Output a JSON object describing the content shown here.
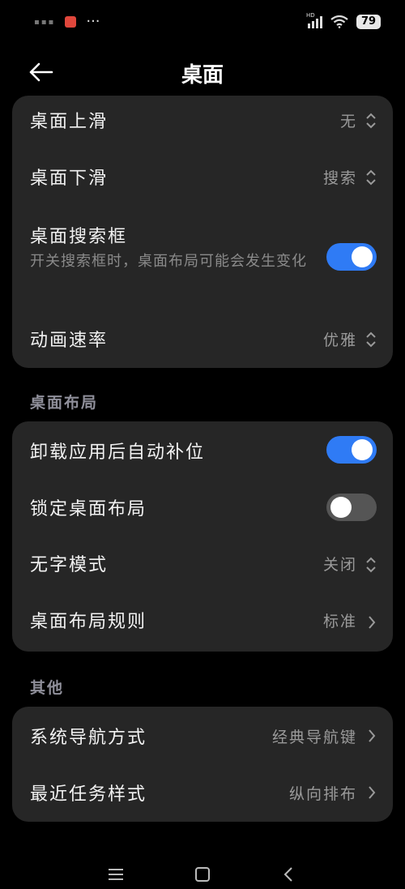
{
  "status_bar": {
    "network": "HD",
    "battery": "79",
    "more": "···"
  },
  "header": {
    "title": "桌面"
  },
  "gestures": {
    "items": [
      {
        "label": "桌面上滑",
        "value": "无"
      },
      {
        "label": "桌面下滑",
        "value": "搜索"
      },
      {
        "label": "桌面搜索框",
        "sub": "开关搜索框时，桌面布局可能会发生变化",
        "toggle": true
      },
      {
        "label": "动画速率",
        "value": "优雅"
      }
    ]
  },
  "layout_section": {
    "title": "桌面布局",
    "items": [
      {
        "label": "卸载应用后自动补位",
        "toggle": true
      },
      {
        "label": "锁定桌面布局",
        "toggle": false
      },
      {
        "label": "无字模式",
        "value": "关闭"
      },
      {
        "label": "桌面布局规则",
        "value": "标准"
      }
    ]
  },
  "other_section": {
    "title": "其他",
    "items": [
      {
        "label": "系统导航方式",
        "value": "经典导航键"
      },
      {
        "label": "最近任务样式",
        "value": "纵向排布"
      }
    ]
  },
  "colors": {
    "accent": "#2f7bf5",
    "card": "#262626",
    "background": "#000000"
  }
}
